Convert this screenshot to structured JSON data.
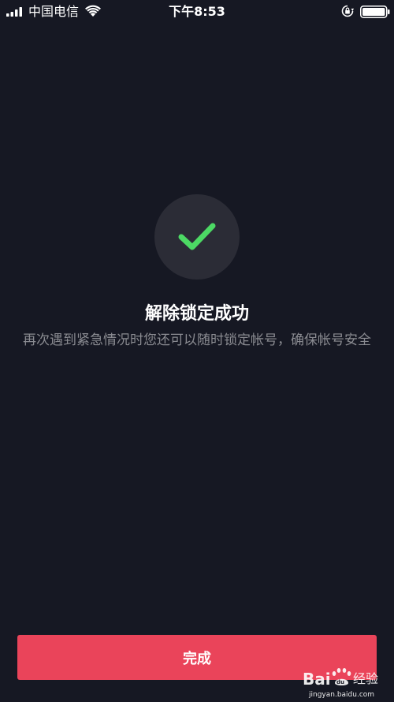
{
  "status_bar": {
    "carrier": "中国电信",
    "time": "下午8:53"
  },
  "content": {
    "title": "解除锁定成功",
    "subtitle": "再次遇到紧急情况时您还可以随时锁定帐号，确保帐号安全",
    "check_color": "#4cd964"
  },
  "footer": {
    "done_label": "完成",
    "accent_color": "#ea445a"
  },
  "watermark": {
    "brand": "Baidu经验",
    "url": "jingyan.baidu.com"
  }
}
